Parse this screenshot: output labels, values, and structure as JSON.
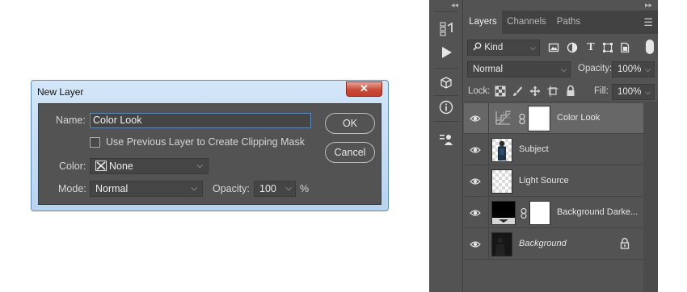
{
  "dialog": {
    "title": "New Layer",
    "close_glyph": "✕",
    "name_label": "Name:",
    "name_value": "Color Look",
    "clip_label": "Use Previous Layer to Create Clipping Mask",
    "clip_checked": false,
    "color_label": "Color:",
    "color_value": "None",
    "mode_label": "Mode:",
    "mode_value": "Normal",
    "opacity_label": "Opacity:",
    "opacity_value": "100",
    "opacity_unit": "%",
    "ok_label": "OK",
    "cancel_label": "Cancel"
  },
  "panel": {
    "collapse_left": "◂◂",
    "collapse_right": "▸▸",
    "tabs": [
      "Layers",
      "Channels",
      "Paths"
    ],
    "active_tab": "Layers",
    "kind_label": "Kind",
    "blend_mode": "Normal",
    "opacity_label": "Opacity:",
    "opacity_value": "100%",
    "lock_label": "Lock:",
    "fill_label": "Fill:",
    "fill_value": "100%",
    "tool_icons": [
      "history-brush-icon",
      "play-icon",
      "3d-cube-icon",
      "info-icon",
      "properties-icon"
    ],
    "filter_icons": [
      "image-filter-icon",
      "adjustment-filter-icon",
      "type-filter-icon",
      "shape-filter-icon",
      "smart-object-filter-icon"
    ],
    "layers": [
      {
        "name": "Color Look",
        "selected": true,
        "italic": false,
        "thumb": "adjustment",
        "mask": true,
        "locked": false
      },
      {
        "name": "Subject",
        "selected": false,
        "italic": false,
        "thumb": "person",
        "mask": false,
        "locked": false
      },
      {
        "name": "Light Source",
        "selected": false,
        "italic": false,
        "thumb": "transparent",
        "mask": false,
        "locked": false
      },
      {
        "name": "Background Darke...",
        "selected": false,
        "italic": false,
        "thumb": "black",
        "mask": true,
        "locked": false
      },
      {
        "name": "Background",
        "selected": false,
        "italic": true,
        "thumb": "dark-photo",
        "mask": false,
        "locked": true
      }
    ]
  }
}
